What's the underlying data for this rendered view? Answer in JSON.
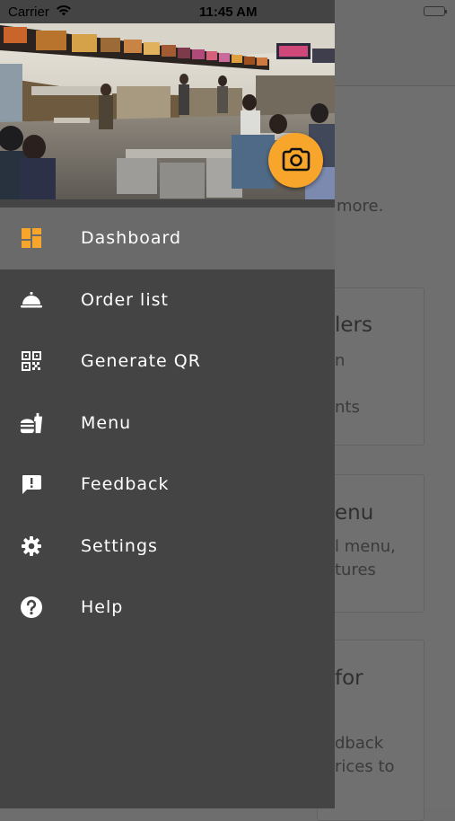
{
  "status_bar": {
    "carrier": "Carrier",
    "time": "11:45 AM"
  },
  "background": {
    "lines": [
      "more.",
      "lers",
      "n",
      "nts",
      "enu",
      "l menu,",
      "tures",
      "for",
      "dback",
      "rices to"
    ]
  },
  "drawer": {
    "accent_color": "#f8a52b",
    "items": [
      {
        "label": "Dashboard",
        "icon": "dashboard-icon",
        "active": true
      },
      {
        "label": "Order list",
        "icon": "cloche-icon"
      },
      {
        "label": "Generate QR",
        "icon": "qr-code-icon"
      },
      {
        "label": "Menu",
        "icon": "fastfood-icon"
      },
      {
        "label": "Feedback",
        "icon": "feedback-icon"
      },
      {
        "label": "Settings",
        "icon": "gear-icon"
      },
      {
        "label": "Help",
        "icon": "help-icon"
      }
    ]
  }
}
